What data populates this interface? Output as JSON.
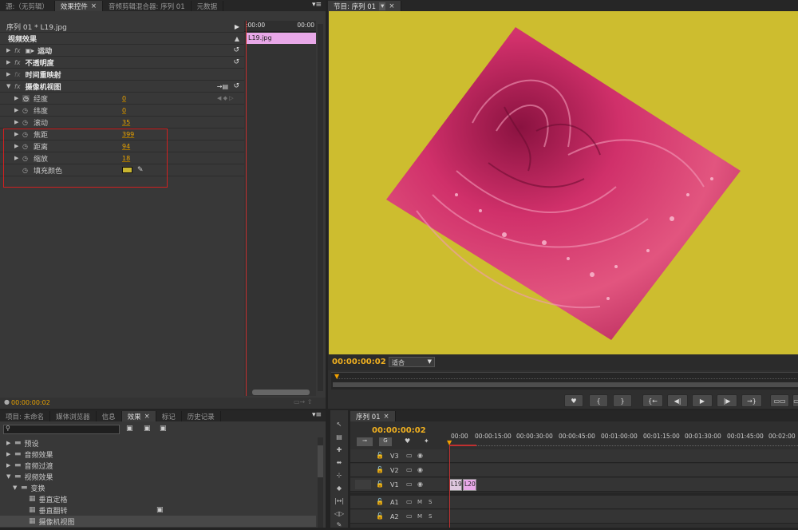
{
  "effect_controls": {
    "tabs": [
      {
        "label": "源:（无剪辑）",
        "active": false
      },
      {
        "label": "效果控件",
        "active": true
      },
      {
        "label": "音频剪辑混合器: 序列 01",
        "active": false
      },
      {
        "label": "元数据",
        "active": false
      }
    ],
    "sequence_label": "序列 01 * L19.jpg",
    "section_title": "视频效果",
    "clip_label": "L19.jpg",
    "mini_timecode": ":00:00",
    "mini_timecode_end": "00:00",
    "effects": [
      {
        "name": "运动",
        "fx": "fx",
        "bold": true
      },
      {
        "name": "不透明度",
        "fx": "fx",
        "bold": true
      },
      {
        "name": "时间重映射",
        "fx": "fx",
        "bold": true
      },
      {
        "name": "摄像机视图",
        "fx": "fx",
        "bold": true
      }
    ],
    "params": [
      {
        "name": "经度",
        "value": "0"
      },
      {
        "name": "纬度",
        "value": "0"
      },
      {
        "name": "滚动",
        "value": "35"
      },
      {
        "name": "焦距",
        "value": "399"
      },
      {
        "name": "距离",
        "value": "94"
      },
      {
        "name": "缩放",
        "value": "18"
      }
    ],
    "fill_color_label": "填充颜色",
    "fill_color": "#c8b530",
    "footer_timecode": "00:00:00:02"
  },
  "program": {
    "tab": "节目: 序列 01",
    "timecode": "00:00:00:02",
    "fit_label": "适合",
    "background_color": "#cdbd2f",
    "image_subject": "rose-photo"
  },
  "project": {
    "tabs": [
      {
        "label": "项目: 未命名",
        "active": false
      },
      {
        "label": "媒体浏览器",
        "active": false
      },
      {
        "label": "信息",
        "active": false
      },
      {
        "label": "效果",
        "active": true
      },
      {
        "label": "标记",
        "active": false
      },
      {
        "label": "历史记录",
        "active": false
      }
    ],
    "search_placeholder": "",
    "tree": [
      {
        "label": "预设",
        "level": 0,
        "type": "folder"
      },
      {
        "label": "音频效果",
        "level": 0,
        "type": "folder"
      },
      {
        "label": "音频过渡",
        "level": 0,
        "type": "folder"
      },
      {
        "label": "视频效果",
        "level": 0,
        "type": "folder",
        "open": true
      },
      {
        "label": "变换",
        "level": 1,
        "type": "folder",
        "open": true
      },
      {
        "label": "垂直定格",
        "level": 2,
        "type": "effect"
      },
      {
        "label": "垂直翻转",
        "level": 2,
        "type": "effect"
      },
      {
        "label": "摄像机视图",
        "level": 2,
        "type": "effect",
        "selected": true
      }
    ]
  },
  "timeline": {
    "tab": "序列 01",
    "timecode": "00:00:00:02",
    "ruler": [
      "00:00",
      "00:00:15:00",
      "00:00:30:00",
      "00:00:45:00",
      "00:01:00:00",
      "00:01:15:00",
      "00:01:30:00",
      "00:01:45:00",
      "00:02:00"
    ],
    "video_tracks": [
      "V3",
      "V2",
      "V1"
    ],
    "audio_tracks": [
      "A1",
      "A2"
    ],
    "clips": [
      "L19",
      "L20"
    ]
  }
}
